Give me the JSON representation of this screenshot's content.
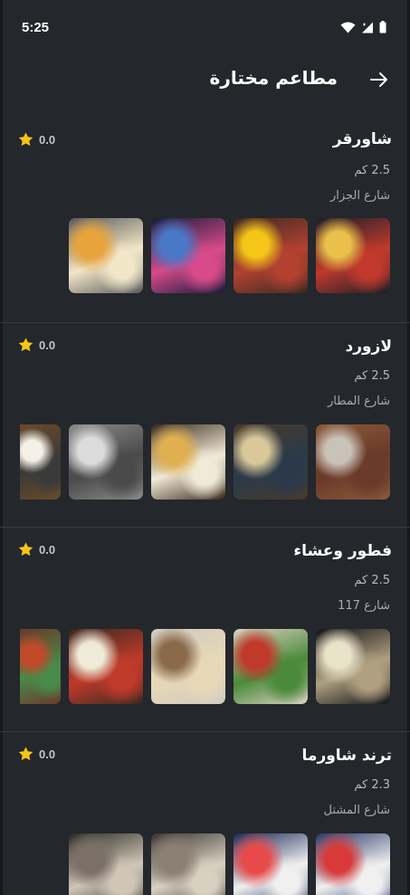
{
  "status_bar": {
    "time": "5:25",
    "icons": [
      "wifi-icon",
      "signal-icon",
      "battery-icon"
    ]
  },
  "header": {
    "title": "مطاعم مختارة",
    "back_icon": "arrow-right-icon"
  },
  "restaurants": [
    {
      "name": "شاورقر",
      "rating": "0.0",
      "distance": "2.5 كم",
      "street": "شارع الجزار",
      "photos": [
        {
          "label": "night-storefront",
          "colors": [
            "#1b1f2a",
            "#e8c04a",
            "#c0392b"
          ]
        },
        {
          "label": "yellow-balloons-storefront",
          "colors": [
            "#3a2a22",
            "#f5c518",
            "#b24130"
          ]
        },
        {
          "label": "illuminated-exterior",
          "colors": [
            "#141c3a",
            "#4a78c8",
            "#d84a8a"
          ]
        },
        {
          "label": "food-plates",
          "colors": [
            "#5a5a5a",
            "#e8a33a",
            "#f2e6c8"
          ]
        }
      ]
    },
    {
      "name": "لازورد",
      "rating": "0.0",
      "distance": "2.5 كم",
      "street": "شارع المطار",
      "photos": [
        {
          "label": "outdoor-patio",
          "colors": [
            "#8a5a3a",
            "#c9c2b8",
            "#6a3a2a"
          ]
        },
        {
          "label": "indoor-seating-drink",
          "colors": [
            "#4a3a2a",
            "#d9c89a",
            "#2a3a4a"
          ]
        },
        {
          "label": "pizza-and-coffee",
          "colors": [
            "#3a2a1a",
            "#e0b050",
            "#f0ead8"
          ]
        },
        {
          "label": "long-table-terrace",
          "colors": [
            "#8a8a8a",
            "#dcdcdc",
            "#4a4a4a"
          ]
        },
        {
          "label": "coffee-cup",
          "colors": [
            "#6a4a2a",
            "#f4f0e8",
            "#3a3a3a"
          ]
        }
      ]
    },
    {
      "name": "فطور وعشاء",
      "rating": "0.0",
      "distance": "2.5 كم",
      "street": "شارع 117",
      "photos": [
        {
          "label": "shop-front-night",
          "colors": [
            "#121418",
            "#e8e2c8",
            "#b0a080"
          ]
        },
        {
          "label": "mini-pizzas",
          "colors": [
            "#d8d0c0",
            "#c0392b",
            "#4a8a3a"
          ]
        },
        {
          "label": "wraps-tray",
          "colors": [
            "#cfcac0",
            "#8a6a4a",
            "#e8d8b8"
          ]
        },
        {
          "label": "pastry-boxes",
          "colors": [
            "#3a2a20",
            "#f0ead8",
            "#c03a2a"
          ]
        },
        {
          "label": "flatbread-toppings",
          "colors": [
            "#6a3a2a",
            "#c04a2a",
            "#4a8a4a"
          ]
        }
      ]
    },
    {
      "name": "ترند شاورما",
      "rating": "0.0",
      "distance": "2.3 كم",
      "street": "شارع المشتل",
      "photos": [
        {
          "label": "trend-sign",
          "colors": [
            "#2a3a6a",
            "#d83a3a",
            "#f0f0f0"
          ]
        },
        {
          "label": "neon-storefront",
          "colors": [
            "#1a2a5a",
            "#e84a4a",
            "#f0f0f0"
          ]
        },
        {
          "label": "dining-hall",
          "colors": [
            "#3a3430",
            "#8a8074",
            "#d8d0c0"
          ]
        },
        {
          "label": "dining-hall-2",
          "colors": [
            "#2e2a26",
            "#7a7068",
            "#cfc6b6"
          ]
        }
      ]
    }
  ],
  "colors": {
    "background": "#24272c",
    "star": "#f5c518",
    "divider": "#383c42"
  }
}
